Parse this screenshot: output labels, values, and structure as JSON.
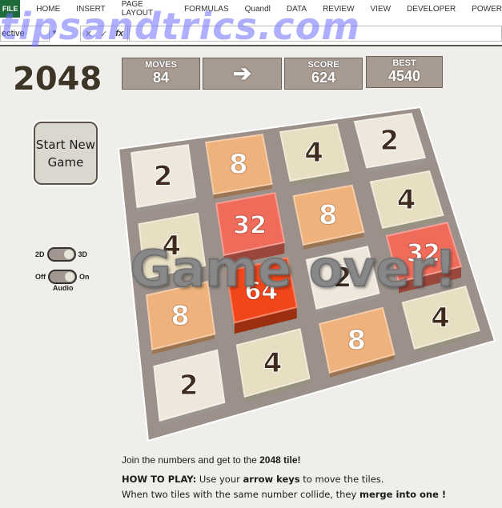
{
  "ribbon": {
    "file": "FILE",
    "tabs": [
      "HOME",
      "INSERT",
      "PAGE LAYOUT",
      "FORMULAS",
      "Quandl",
      "DATA",
      "REVIEW",
      "VIEW",
      "DEVELOPER",
      "POWER"
    ]
  },
  "formula_bar": {
    "name_box": "ective",
    "cancel_icon": "✕",
    "confirm_icon": "✓",
    "fx_label": "fx"
  },
  "watermark": "tipsandtrics.com",
  "game": {
    "title": "2048",
    "moves_label": "MOVES",
    "moves_value": "84",
    "direction_icon": "➔",
    "score_label": "SCORE",
    "score_value": "624",
    "best_label": "BEST",
    "best_value": "4540",
    "new_game_line1": "Start New",
    "new_game_line2": "Game",
    "toggle_view": {
      "left": "2D",
      "right": "3D",
      "state": "3D"
    },
    "toggle_audio": {
      "left": "Off",
      "right": "On",
      "state": "On",
      "label": "Audio"
    },
    "game_over": "Game over!",
    "board": [
      [
        2,
        8,
        4,
        2
      ],
      [
        4,
        32,
        8,
        4
      ],
      [
        8,
        64,
        2,
        32
      ],
      [
        2,
        4,
        8,
        4
      ]
    ],
    "tile_colors": {
      "2": "#eee7dc",
      "4": "#e8dfc3",
      "8": "#efb27c",
      "32": "#ef6b5a",
      "64": "#f0461a"
    },
    "tile_text_colors": {
      "2": "#3e2b1e",
      "4": "#3e2b1e",
      "8": "#ffffff",
      "32": "#ffffff",
      "64": "#ffffff"
    }
  },
  "instructions": {
    "line1_pre": "Join the numbers and get to the ",
    "line1_bold": "2048 tile!",
    "how_label": "HOW TO PLAY:",
    "how_pre": " Use your ",
    "how_bold": "arrow keys",
    "how_post": " to move the tiles.",
    "line3_pre": "When two tiles with the same number collide, they ",
    "line3_bold": "merge into one !"
  }
}
